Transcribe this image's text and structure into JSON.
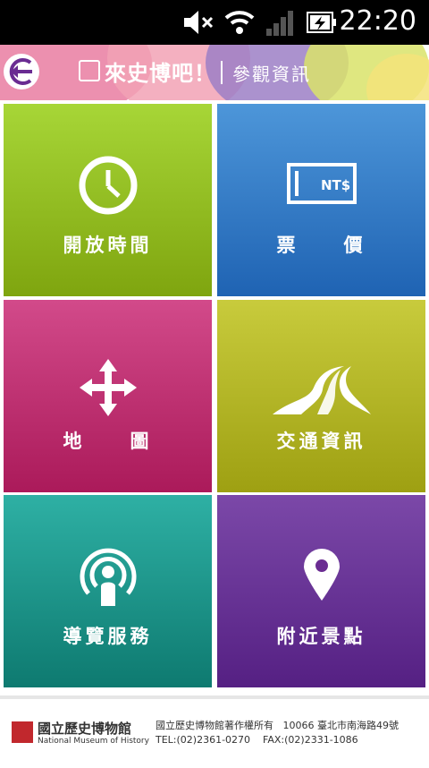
{
  "status_bar": {
    "time": "22:20"
  },
  "header": {
    "app_title": "來史博吧！",
    "section_title": "參觀資訊"
  },
  "tiles": [
    {
      "label": "開放時間",
      "color": "#8dbb1a",
      "icon": "clock-icon"
    },
    {
      "label": "票　　價",
      "color": "#2a78c8",
      "icon": "ticket-icon"
    },
    {
      "label": "地　　圖",
      "color": "#c0246c",
      "icon": "move-arrows-icon"
    },
    {
      "label": "交通資訊",
      "color": "#a9ac18",
      "icon": "road-icon"
    },
    {
      "label": "導覽服務",
      "color": "#16968a",
      "icon": "audio-guide-icon"
    },
    {
      "label": "附近景點",
      "color": "#6a2c92",
      "icon": "location-pin-icon"
    }
  ],
  "ticket_text": "NT$",
  "footer": {
    "org_name": "國立歷史博物館",
    "org_name_en": "National Museum of History",
    "copyright": "國立歷史博物館著作權所有",
    "address": "10066 臺北市南海路49號",
    "tel": "TEL:(02)2361-0270",
    "fax": "FAX:(02)2331-1086"
  }
}
